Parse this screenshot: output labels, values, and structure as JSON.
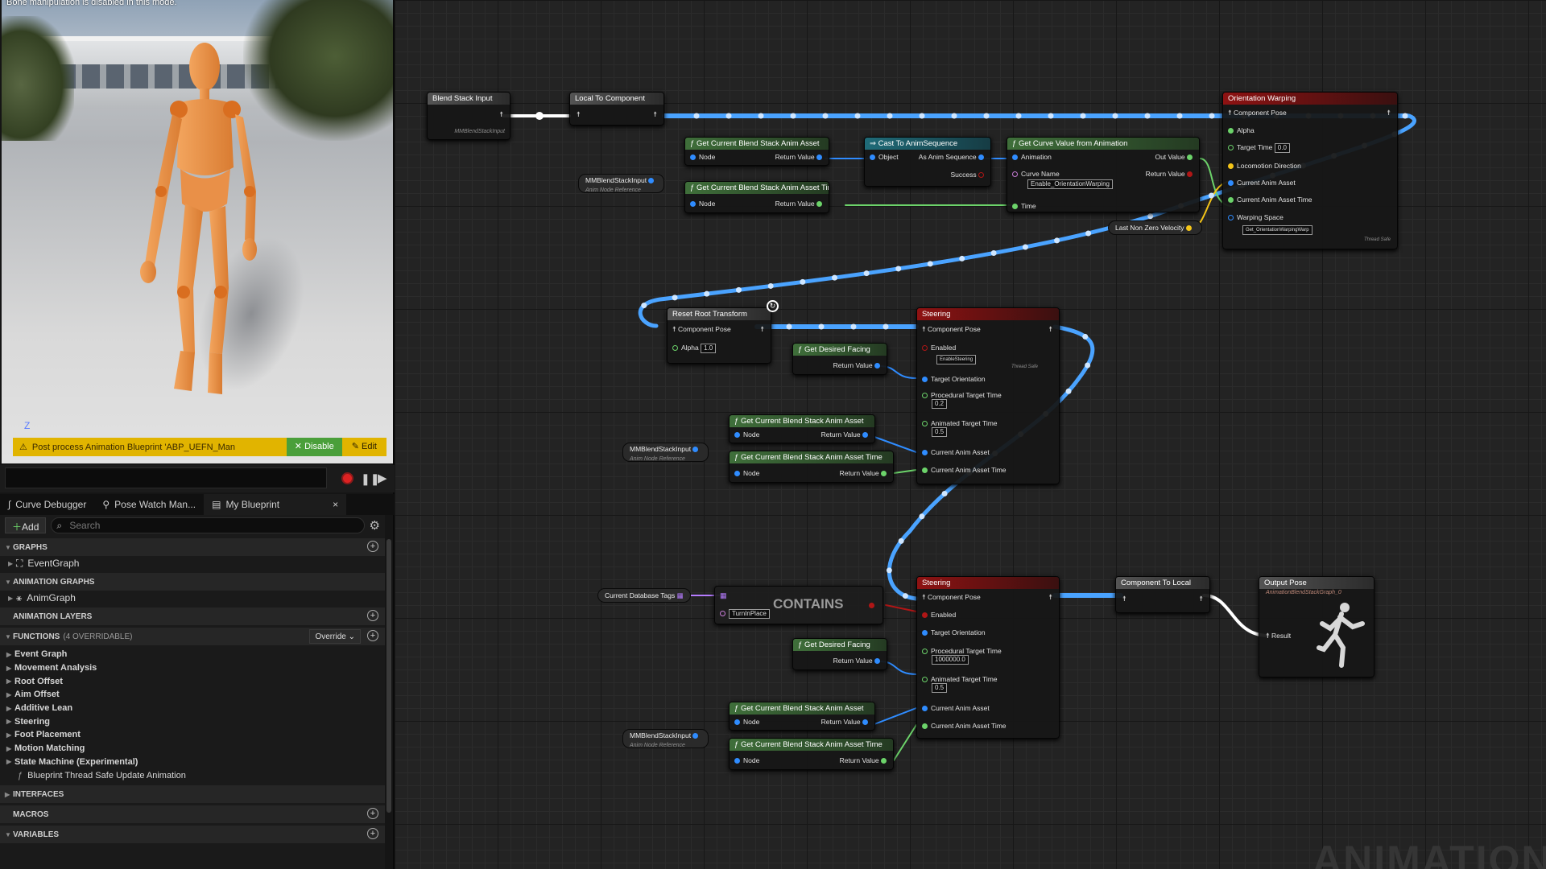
{
  "viewport": {
    "message": "Bone manipulation is disabled in this mode.",
    "axis_label": "Z",
    "warning": {
      "text": "Post process Animation Blueprint 'ABP_UEFN_Man",
      "disable_label": "Disable",
      "edit_label": "Edit"
    }
  },
  "tabs": [
    {
      "label": "Curve Debugger"
    },
    {
      "label": "Pose Watch Man..."
    },
    {
      "label": "My Blueprint",
      "close": "×"
    }
  ],
  "mybp": {
    "add_label": "Add",
    "search_placeholder": "Search",
    "graphs_header": "GRAPHS",
    "event_graph": "EventGraph",
    "anim_graphs_header": "ANIMATION GRAPHS",
    "anim_graph": "AnimGraph",
    "anim_layers_header": "ANIMATION LAYERS",
    "functions_header": "FUNCTIONS",
    "functions_count": "(4 OVERRIDABLE)",
    "override_label": "Override",
    "functions": [
      "Event Graph",
      "Movement Analysis",
      "Root Offset",
      "Aim Offset",
      "Additive Lean",
      "Steering",
      "Foot Placement",
      "Motion Matching",
      "State Machine (Experimental)"
    ],
    "thread_safe": "Blueprint Thread Safe Update Animation",
    "interfaces_header": "INTERFACES",
    "macros_header": "MACROS",
    "variables_header": "VARIABLES"
  },
  "graph": {
    "blend_stack_input": {
      "title": "Blend Stack Input",
      "sub": "MMBlendStackInput"
    },
    "local_to_component": {
      "title": "Local To Component"
    },
    "get_asset_1": {
      "title": "Get Current Blend Stack Anim Asset",
      "node": "Node",
      "ret": "Return Value"
    },
    "get_time_1": {
      "title": "Get Current Blend Stack Anim Asset Time",
      "node": "Node",
      "ret": "Return Value"
    },
    "mm_input_1": {
      "label": "MMBlendStackInput",
      "sub": "Anim Node Reference"
    },
    "cast": {
      "title": "Cast To AnimSequence",
      "object": "Object",
      "as": "As Anim Sequence",
      "success": "Success"
    },
    "curve": {
      "title": "Get Curve Value from Animation",
      "animation": "Animation",
      "out": "Out Value",
      "curve_name": "Curve Name",
      "ret": "Return Value",
      "curve_value": "Enable_OrientationWarping",
      "time": "Time"
    },
    "last_velocity": {
      "label": "Last Non Zero Velocity"
    },
    "orient": {
      "title": "Orientation Warping",
      "pose": "Component Pose",
      "alpha": "Alpha",
      "target_time": "Target Time",
      "target_time_value": "0.0",
      "loco": "Locomotion Direction",
      "asset": "Current Anim Asset",
      "asset_time": "Current Anim Asset Time",
      "warping": "Warping Space",
      "warping_value": "Get_OrientationWarpingWarp",
      "thread_safe": "Thread Safe"
    },
    "reset_root": {
      "title": "Reset Root Transform",
      "pose": "Component Pose",
      "alpha": "Alpha",
      "alpha_value": "1.0"
    },
    "facing_1": {
      "title": "Get Desired Facing",
      "ret": "Return Value"
    },
    "steer_1": {
      "title": "Steering",
      "pose": "Component Pose",
      "enabled": "Enabled",
      "enabled_value": "EnableSteering",
      "thread_safe": "Thread Safe",
      "target_orient": "Target Orientation",
      "proc_time": "Procedural Target Time",
      "proc_value": "0.2",
      "anim_time": "Animated Target Time",
      "anim_value": "0.5",
      "asset": "Current Anim Asset",
      "asset_time": "Current Anim Asset Time"
    },
    "get_asset_2": {
      "title": "Get Current Blend Stack Anim Asset",
      "node": "Node",
      "ret": "Return Value"
    },
    "get_time_2": {
      "title": "Get Current Blend Stack Anim Asset Time",
      "node": "Node",
      "ret": "Return Value"
    },
    "mm_input_2": {
      "label": "MMBlendStackInput",
      "sub": "Anim Node Reference"
    },
    "db_tags": {
      "label": "Current Database Tags"
    },
    "contains": {
      "title": "CONTAINS",
      "value": "TurnInPlace"
    },
    "facing_2": {
      "title": "Get Desired Facing",
      "ret": "Return Value"
    },
    "steer_2": {
      "title": "Steering",
      "pose": "Component Pose",
      "enabled": "Enabled",
      "target_orient": "Target Orientation",
      "proc_time": "Procedural Target Time",
      "proc_value": "1000000.0",
      "anim_time": "Animated Target Time",
      "anim_value": "0.5",
      "asset": "Current Anim Asset",
      "asset_time": "Current Anim Asset Time"
    },
    "get_asset_3": {
      "title": "Get Current Blend Stack Anim Asset",
      "node": "Node",
      "ret": "Return Value"
    },
    "get_time_3": {
      "title": "Get Current Blend Stack Anim Asset Time",
      "node": "Node",
      "ret": "Return Value"
    },
    "mm_input_3": {
      "label": "MMBlendStackInput",
      "sub": "Anim Node Reference"
    },
    "comp_to_local": {
      "title": "Component To Local"
    },
    "output_pose": {
      "title": "Output Pose",
      "sub": "AnimationBlendStackGraph_0",
      "result": "Result"
    },
    "watermark": "ANIMATION"
  },
  "colors": {
    "pose_wire": "#4aa3ff",
    "float_pin": "#6cd36a",
    "object_pin": "#2f8cff",
    "bool_pin": "#b01616",
    "struct_pin": "#f5c518",
    "warning": "#e1b400"
  }
}
